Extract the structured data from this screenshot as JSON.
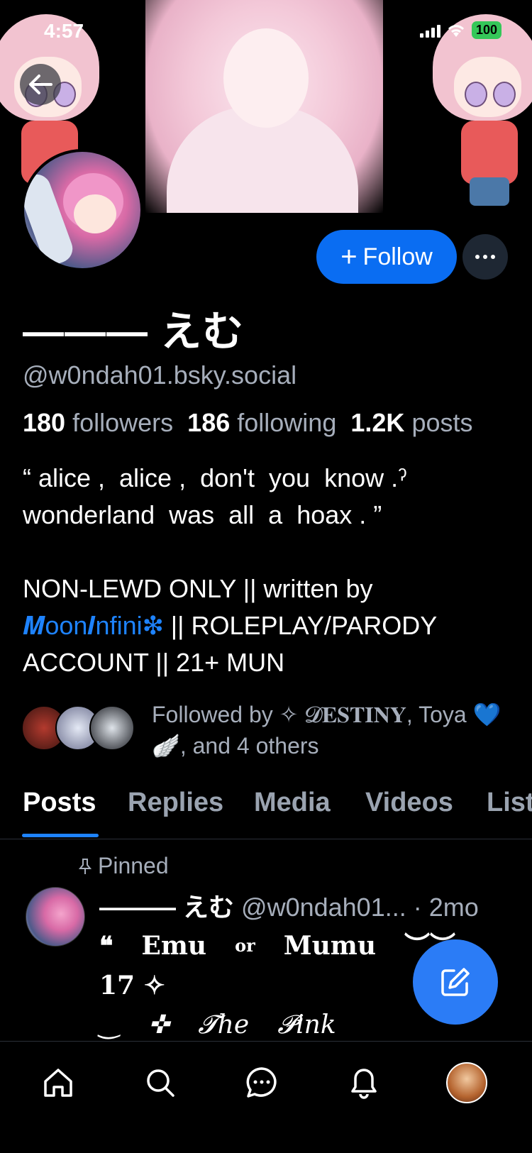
{
  "status_bar": {
    "time": "4:57",
    "battery": "100"
  },
  "profile": {
    "display_name": "——— えむ",
    "handle": "@w0ndah01.bsky.social",
    "follow_label": "Follow",
    "stats": {
      "followers_count": "180",
      "followers_label": "followers",
      "following_count": "186",
      "following_label": "following",
      "posts_count": "1.2K",
      "posts_label": "posts"
    },
    "bio": {
      "line1": "“ alice ,  alice ,  don't  you  know .ˀ",
      "line2": "wonderland  was  all  a  hoax . ”",
      "line3": "NON-LEWD ONLY || written by",
      "link": "𝑴oon𝑰nfini❇",
      "line4_rest": " || ROLEPLAY/PARODY",
      "line5": "ACCOUNT || 21+ MUN"
    },
    "followed_by": "Followed by ✧ 𝓓𝐄𝐒𝐓𝐈𝐍𝐘, Toya 💙🪽, and 4 others"
  },
  "tabs": [
    "Posts",
    "Replies",
    "Media",
    "Videos",
    "Lists"
  ],
  "post": {
    "pinned_label": "Pinned",
    "author_name": "——— えむ",
    "author_handle": "@w0ndah01...",
    "time": "· 2mo",
    "line1_a": "❝",
    "line1_b": "𝐄mu",
    "line1_c": "or",
    "line1_d": "𝐌umu",
    "line1_e": "︶︶",
    "line2": "17   ✧",
    "line3_a": "‿",
    "line3_b": "✜",
    "line3_c": "𝓣he",
    "line3_d": "𝓟ink"
  },
  "colors": {
    "accent": "#0a6df2",
    "link": "#1e83ff",
    "muted": "#a6aebb",
    "background": "#000000"
  },
  "icons": {
    "back": "arrow-left-icon",
    "more": "ellipsis-icon",
    "pin": "pin-icon",
    "compose": "compose-icon",
    "nav": [
      "home-icon",
      "search-icon",
      "chat-icon",
      "bell-icon",
      "profile-avatar"
    ]
  }
}
